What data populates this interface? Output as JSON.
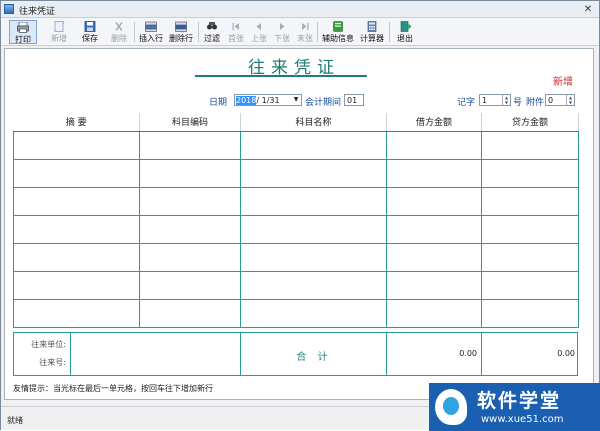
{
  "window": {
    "title": "往来凭证",
    "close": "✕"
  },
  "toolbar": {
    "items": [
      {
        "label": "打印",
        "icon": "print-icon"
      },
      {
        "label": "新增",
        "icon": "new-icon"
      },
      {
        "label": "保存",
        "icon": "save-icon"
      },
      {
        "label": "删除",
        "icon": "delete-icon"
      },
      {
        "label": "插入行",
        "icon": "insert-row-icon"
      },
      {
        "label": "删除行",
        "icon": "delete-row-icon"
      },
      {
        "label": "过滤",
        "icon": "filter-icon"
      },
      {
        "label": "首张",
        "icon": "first-icon"
      },
      {
        "label": "上张",
        "icon": "prev-icon"
      },
      {
        "label": "下张",
        "icon": "next-icon"
      },
      {
        "label": "末张",
        "icon": "last-icon"
      },
      {
        "label": "辅助信息",
        "icon": "info-icon"
      },
      {
        "label": "计算器",
        "icon": "calculator-icon"
      },
      {
        "label": "退出",
        "icon": "exit-icon"
      }
    ]
  },
  "doc": {
    "title": "往来凭证",
    "status": "新增",
    "date_label": "日期",
    "date_year": "2018",
    "date_rest": "/ 1/31",
    "period_label": "会计期间",
    "period_value": "01",
    "jizi_label": "记字",
    "jizi_value": "1",
    "hao_label": "号",
    "fujian_label": "附件",
    "fujian_value": "0"
  },
  "grid": {
    "headers": [
      "摘 要",
      "科目编码",
      "科目名称",
      "借方金额",
      "贷方金额"
    ],
    "rows": 7
  },
  "totals": {
    "unit_label": "往来单位:",
    "no_label": "往来号:",
    "sum_label": "合 计",
    "debit": "0.00",
    "credit": "0.00"
  },
  "tip": "友情提示：当光标在最后一单元格，按回车往下增加新行",
  "statusbar": {
    "text": "就绪"
  },
  "brand": {
    "name": "软件学堂",
    "url": "www.xue51.com"
  },
  "colors": {
    "accent": "#1f7c76",
    "status_new": "#e02020",
    "label_blue": "#1a4ca0"
  }
}
